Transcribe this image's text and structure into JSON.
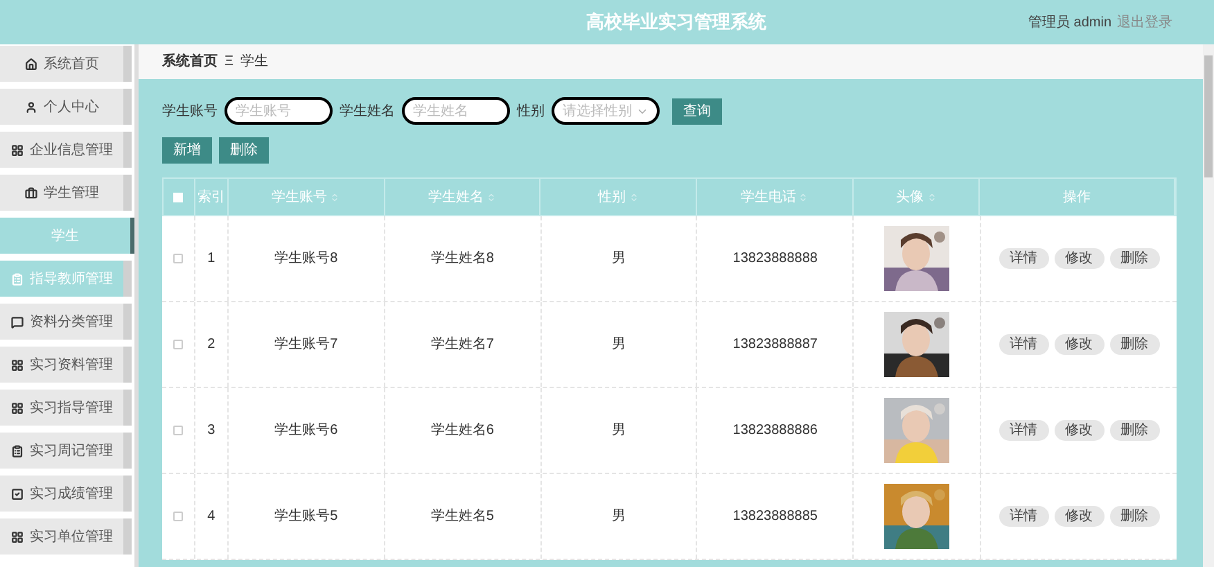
{
  "header": {
    "title": "高校毕业实习管理系统",
    "user": "管理员 admin",
    "logout": "退出登录"
  },
  "sidebar": {
    "items": [
      {
        "label": "系统首页",
        "kind": "menu",
        "selected": false,
        "highlighted": false
      },
      {
        "label": "个人中心",
        "kind": "menu",
        "selected": false,
        "highlighted": false
      },
      {
        "label": "企业信息管理",
        "kind": "menu",
        "selected": false,
        "highlighted": false
      },
      {
        "label": "学生管理",
        "kind": "menu",
        "selected": false,
        "highlighted": false
      },
      {
        "label": "学生",
        "kind": "submenu",
        "selected": true,
        "highlighted": true
      },
      {
        "label": "指导教师管理",
        "kind": "menu",
        "selected": false,
        "highlighted": true
      },
      {
        "label": "资料分类管理",
        "kind": "menu",
        "selected": false,
        "highlighted": false
      },
      {
        "label": "实习资料管理",
        "kind": "menu",
        "selected": false,
        "highlighted": false
      },
      {
        "label": "实习指导管理",
        "kind": "menu",
        "selected": false,
        "highlighted": false
      },
      {
        "label": "实习周记管理",
        "kind": "menu",
        "selected": false,
        "highlighted": false
      },
      {
        "label": "实习成绩管理",
        "kind": "menu",
        "selected": false,
        "highlighted": false
      },
      {
        "label": "实习单位管理",
        "kind": "menu",
        "selected": false,
        "highlighted": false
      }
    ]
  },
  "breadcrumb": {
    "home": "系统首页",
    "separator": "Ξ",
    "current": "学生"
  },
  "search": {
    "fields": [
      {
        "label": "学生账号",
        "placeholder": "学生账号",
        "kind": "input"
      },
      {
        "label": "学生姓名",
        "placeholder": "学生姓名",
        "kind": "input"
      },
      {
        "label": "性别",
        "placeholder": "请选择性别",
        "kind": "select"
      }
    ],
    "button": "查询"
  },
  "actions": [
    "新增",
    "删除"
  ],
  "table": {
    "select_all_checked": false,
    "columns": [
      {
        "label": "索引",
        "sortable": false
      },
      {
        "label": "学生账号",
        "sortable": true
      },
      {
        "label": "学生姓名",
        "sortable": true
      },
      {
        "label": "性别",
        "sortable": true
      },
      {
        "label": "学生电话",
        "sortable": true
      },
      {
        "label": "头像",
        "sortable": true
      },
      {
        "label": "操作",
        "sortable": false
      }
    ],
    "rows": [
      {
        "checked": false,
        "index": "1",
        "account": "学生账号8",
        "name": "学生姓名8",
        "gender": "男",
        "phone": "13823888888",
        "avatar": {
          "kind": "picture"
        },
        "buttons": [
          "详情",
          "修改",
          "删除"
        ]
      },
      {
        "checked": false,
        "index": "2",
        "account": "学生账号7",
        "name": "学生姓名7",
        "gender": "男",
        "phone": "13823888887",
        "avatar": {
          "kind": "picture"
        },
        "buttons": [
          "详情",
          "修改",
          "删除"
        ]
      },
      {
        "checked": false,
        "index": "3",
        "account": "学生账号6",
        "name": "学生姓名6",
        "gender": "男",
        "phone": "13823888886",
        "avatar": {
          "kind": "picture"
        },
        "buttons": [
          "详情",
          "修改",
          "删除"
        ]
      },
      {
        "checked": false,
        "index": "4",
        "account": "学生账号5",
        "name": "学生姓名5",
        "gender": "男",
        "phone": "13823888885",
        "avatar": {
          "kind": "picture"
        },
        "buttons": [
          "详情",
          "修改",
          "删除"
        ]
      }
    ]
  }
}
